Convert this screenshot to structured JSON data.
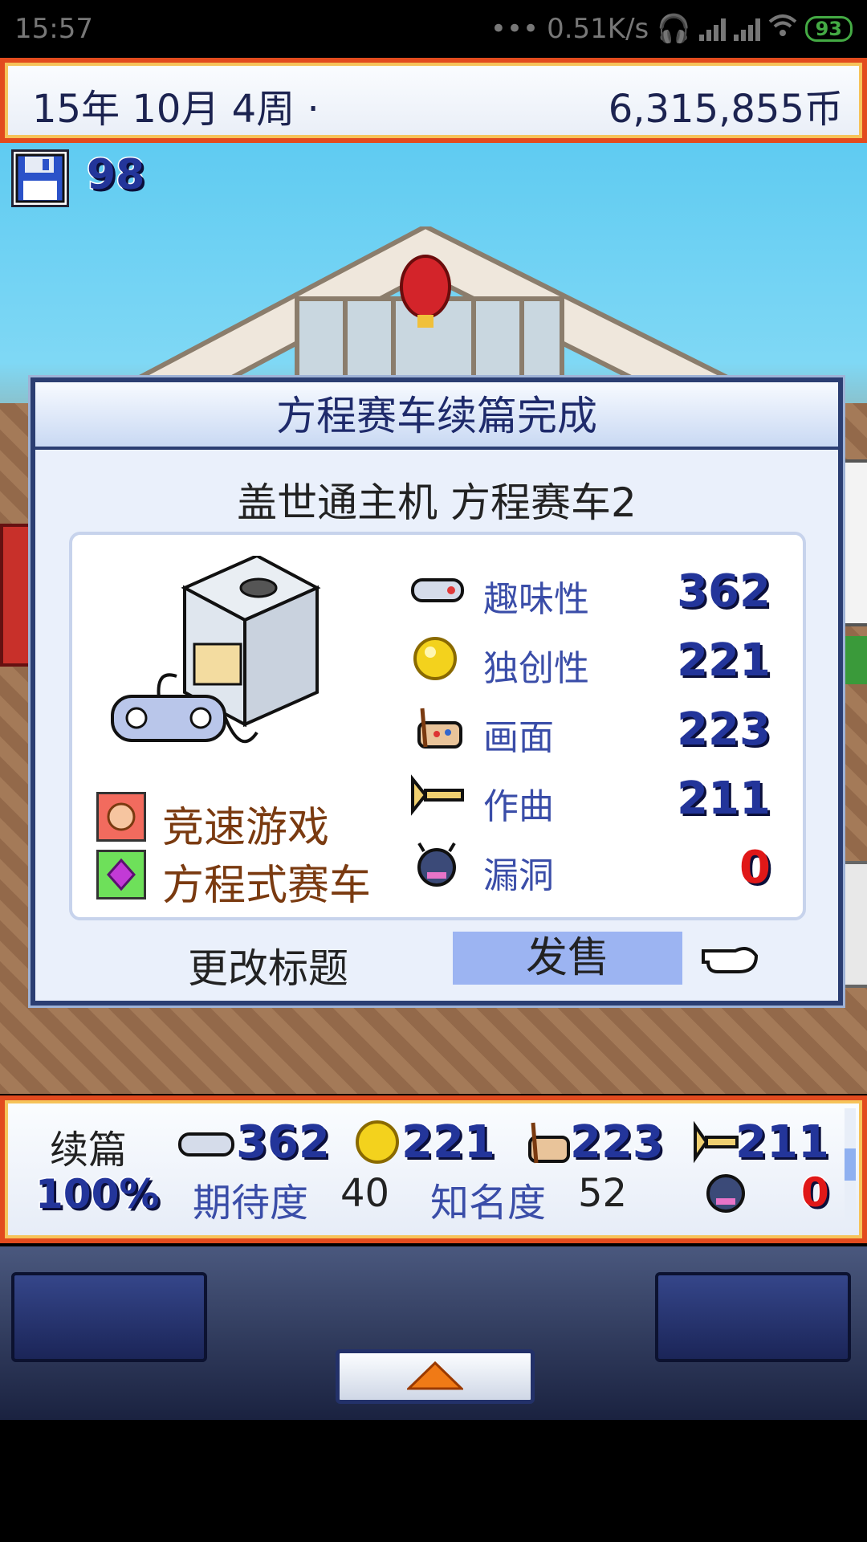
{
  "status_bar": {
    "time": "15:57",
    "network_speed": "0.51K/s",
    "battery": "93"
  },
  "top_bar": {
    "date": "15年 10月 4周 ·",
    "money": "6,315,855币"
  },
  "save_count": "98",
  "dialog": {
    "title": "方程赛车续篇完成",
    "game_name": "盖世通主机 方程赛车2",
    "genres": [
      {
        "icon": "runner-face-icon",
        "label": "竞速游戏"
      },
      {
        "icon": "purple-gem-icon",
        "label": "方程式赛车"
      }
    ],
    "stats": [
      {
        "icon": "gamepad-icon",
        "label": "趣味性",
        "value": "362"
      },
      {
        "icon": "gold-coin-icon",
        "label": "独创性",
        "value": "221"
      },
      {
        "icon": "paint-palette-icon",
        "label": "画面",
        "value": "223"
      },
      {
        "icon": "trumpet-icon",
        "label": "作曲",
        "value": "211"
      },
      {
        "icon": "bug-icon",
        "label": "漏洞",
        "value": "0"
      }
    ],
    "rename_label": "更改标题",
    "sell_label": "发售"
  },
  "bottom_panel": {
    "label": "续篇",
    "percent": "100%",
    "fun": "362",
    "creativity": "221",
    "graphics": "223",
    "sound": "211",
    "bugs": "0",
    "expectation_label": "期待度",
    "expectation": "40",
    "fame_label": "知名度",
    "fame": "52"
  },
  "colors": {
    "frame_red": "#e24b1e",
    "dialog_border": "#2b3e72",
    "sell_highlight": "#9cb4f2",
    "stat_label": "#3a4da8",
    "bug_red": "#e01818"
  }
}
